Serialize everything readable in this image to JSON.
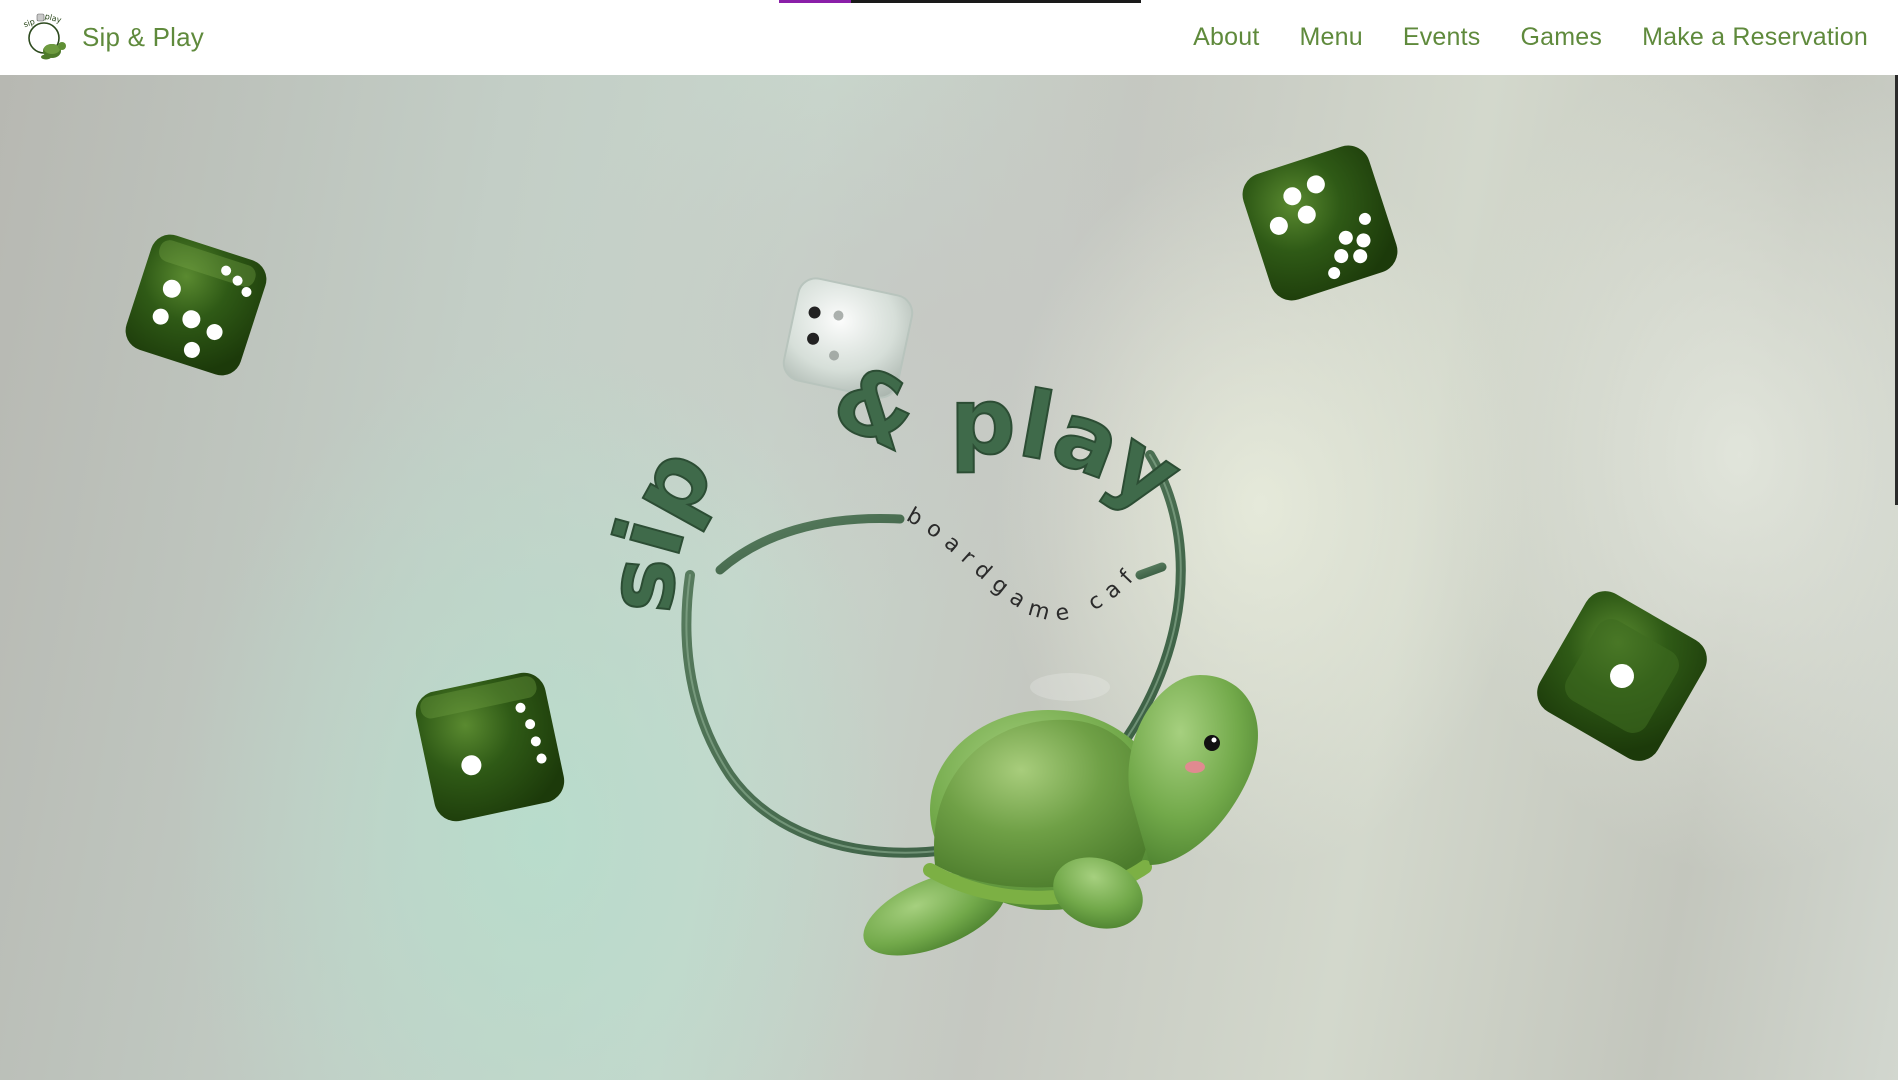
{
  "site": {
    "brand_name": "Sip & Play",
    "logo_text": "sip & play"
  },
  "nav": {
    "items": [
      {
        "label": "About"
      },
      {
        "label": "Menu"
      },
      {
        "label": "Events"
      },
      {
        "label": "Games"
      },
      {
        "label": "Make a Reservation"
      }
    ]
  },
  "hero": {
    "title_word_1": "sip",
    "title_amp": "&",
    "title_word_2": "play",
    "subtitle": "boardgame cafe",
    "mascot": "turtle-icon"
  },
  "scroll_progress": 0.2,
  "colors": {
    "brand_green": "#5f8a3c",
    "dice_green": "#2f5a16",
    "progress_accent": "#8a1fa8"
  }
}
